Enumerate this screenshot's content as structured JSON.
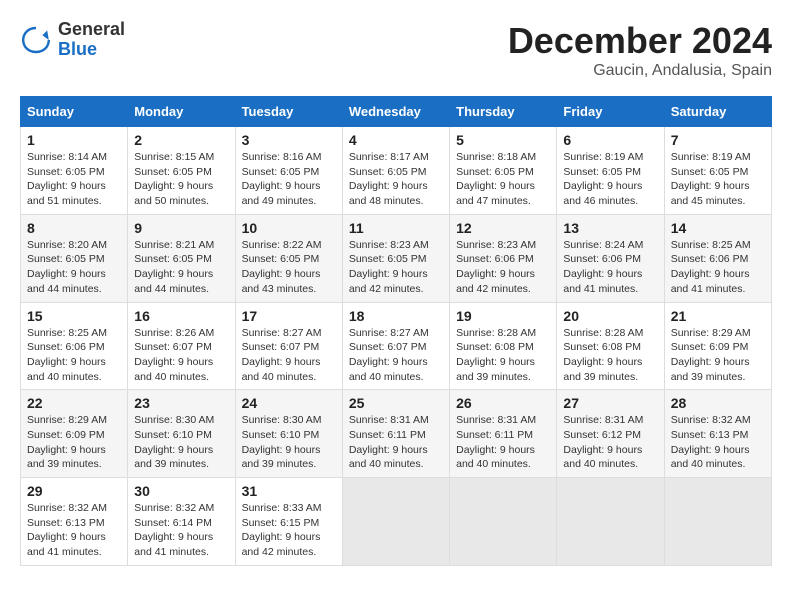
{
  "logo": {
    "general": "General",
    "blue": "Blue"
  },
  "title": "December 2024",
  "location": "Gaucin, Andalusia, Spain",
  "days_of_week": [
    "Sunday",
    "Monday",
    "Tuesday",
    "Wednesday",
    "Thursday",
    "Friday",
    "Saturday"
  ],
  "weeks": [
    [
      {
        "day": "1",
        "sunrise": "8:14 AM",
        "sunset": "6:05 PM",
        "daylight": "9 hours and 51 minutes."
      },
      {
        "day": "2",
        "sunrise": "8:15 AM",
        "sunset": "6:05 PM",
        "daylight": "9 hours and 50 minutes."
      },
      {
        "day": "3",
        "sunrise": "8:16 AM",
        "sunset": "6:05 PM",
        "daylight": "9 hours and 49 minutes."
      },
      {
        "day": "4",
        "sunrise": "8:17 AM",
        "sunset": "6:05 PM",
        "daylight": "9 hours and 48 minutes."
      },
      {
        "day": "5",
        "sunrise": "8:18 AM",
        "sunset": "6:05 PM",
        "daylight": "9 hours and 47 minutes."
      },
      {
        "day": "6",
        "sunrise": "8:19 AM",
        "sunset": "6:05 PM",
        "daylight": "9 hours and 46 minutes."
      },
      {
        "day": "7",
        "sunrise": "8:19 AM",
        "sunset": "6:05 PM",
        "daylight": "9 hours and 45 minutes."
      }
    ],
    [
      {
        "day": "8",
        "sunrise": "8:20 AM",
        "sunset": "6:05 PM",
        "daylight": "9 hours and 44 minutes."
      },
      {
        "day": "9",
        "sunrise": "8:21 AM",
        "sunset": "6:05 PM",
        "daylight": "9 hours and 44 minutes."
      },
      {
        "day": "10",
        "sunrise": "8:22 AM",
        "sunset": "6:05 PM",
        "daylight": "9 hours and 43 minutes."
      },
      {
        "day": "11",
        "sunrise": "8:23 AM",
        "sunset": "6:05 PM",
        "daylight": "9 hours and 42 minutes."
      },
      {
        "day": "12",
        "sunrise": "8:23 AM",
        "sunset": "6:06 PM",
        "daylight": "9 hours and 42 minutes."
      },
      {
        "day": "13",
        "sunrise": "8:24 AM",
        "sunset": "6:06 PM",
        "daylight": "9 hours and 41 minutes."
      },
      {
        "day": "14",
        "sunrise": "8:25 AM",
        "sunset": "6:06 PM",
        "daylight": "9 hours and 41 minutes."
      }
    ],
    [
      {
        "day": "15",
        "sunrise": "8:25 AM",
        "sunset": "6:06 PM",
        "daylight": "9 hours and 40 minutes."
      },
      {
        "day": "16",
        "sunrise": "8:26 AM",
        "sunset": "6:07 PM",
        "daylight": "9 hours and 40 minutes."
      },
      {
        "day": "17",
        "sunrise": "8:27 AM",
        "sunset": "6:07 PM",
        "daylight": "9 hours and 40 minutes."
      },
      {
        "day": "18",
        "sunrise": "8:27 AM",
        "sunset": "6:07 PM",
        "daylight": "9 hours and 40 minutes."
      },
      {
        "day": "19",
        "sunrise": "8:28 AM",
        "sunset": "6:08 PM",
        "daylight": "9 hours and 39 minutes."
      },
      {
        "day": "20",
        "sunrise": "8:28 AM",
        "sunset": "6:08 PM",
        "daylight": "9 hours and 39 minutes."
      },
      {
        "day": "21",
        "sunrise": "8:29 AM",
        "sunset": "6:09 PM",
        "daylight": "9 hours and 39 minutes."
      }
    ],
    [
      {
        "day": "22",
        "sunrise": "8:29 AM",
        "sunset": "6:09 PM",
        "daylight": "9 hours and 39 minutes."
      },
      {
        "day": "23",
        "sunrise": "8:30 AM",
        "sunset": "6:10 PM",
        "daylight": "9 hours and 39 minutes."
      },
      {
        "day": "24",
        "sunrise": "8:30 AM",
        "sunset": "6:10 PM",
        "daylight": "9 hours and 39 minutes."
      },
      {
        "day": "25",
        "sunrise": "8:31 AM",
        "sunset": "6:11 PM",
        "daylight": "9 hours and 40 minutes."
      },
      {
        "day": "26",
        "sunrise": "8:31 AM",
        "sunset": "6:11 PM",
        "daylight": "9 hours and 40 minutes."
      },
      {
        "day": "27",
        "sunrise": "8:31 AM",
        "sunset": "6:12 PM",
        "daylight": "9 hours and 40 minutes."
      },
      {
        "day": "28",
        "sunrise": "8:32 AM",
        "sunset": "6:13 PM",
        "daylight": "9 hours and 40 minutes."
      }
    ],
    [
      {
        "day": "29",
        "sunrise": "8:32 AM",
        "sunset": "6:13 PM",
        "daylight": "9 hours and 41 minutes."
      },
      {
        "day": "30",
        "sunrise": "8:32 AM",
        "sunset": "6:14 PM",
        "daylight": "9 hours and 41 minutes."
      },
      {
        "day": "31",
        "sunrise": "8:33 AM",
        "sunset": "6:15 PM",
        "daylight": "9 hours and 42 minutes."
      },
      null,
      null,
      null,
      null
    ]
  ]
}
